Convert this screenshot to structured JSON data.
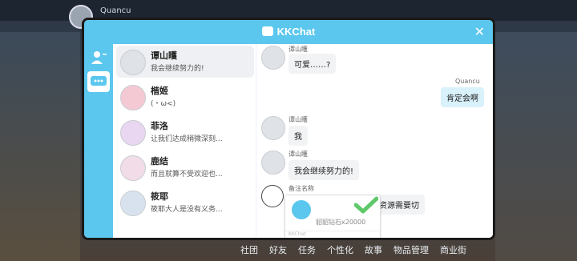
{
  "background": {
    "player_name": "Quancu",
    "nav": [
      "社团",
      "好友",
      "任务",
      "个性化",
      "故事",
      "物品管理",
      "商业街"
    ]
  },
  "dialog": {
    "title": "KKChat",
    "accent": "#5bc7ee"
  },
  "contacts": [
    {
      "name": "谭山矆",
      "message": "我会继续努力的!",
      "active": true
    },
    {
      "name": "楷姬",
      "message": "(・ω<)",
      "active": false
    },
    {
      "name": "菲洛",
      "message": "让我们达成稍微深刻...",
      "active": false
    },
    {
      "name": "鹿结",
      "message": "而且就算不受欢迎也...",
      "active": false
    },
    {
      "name": "筱耶",
      "message": "筱耶大人是没有义务...",
      "active": false
    }
  ],
  "chat": {
    "messages": [
      {
        "sender": "谭山矆",
        "text": "可爱……?",
        "mine": false
      },
      {
        "sender": "Quancu",
        "text": "肯定会啊",
        "mine": true
      },
      {
        "sender": "谭山矆",
        "text": "我",
        "mine": false
      },
      {
        "sender": "谭山矆",
        "text": "我会继续努力的!",
        "mine": false
      }
    ],
    "pending": {
      "label": "备注名称",
      "reply_text": "资源需要切",
      "card_text": "貂貂钻石x20000",
      "card_footer": "KKChat"
    }
  }
}
